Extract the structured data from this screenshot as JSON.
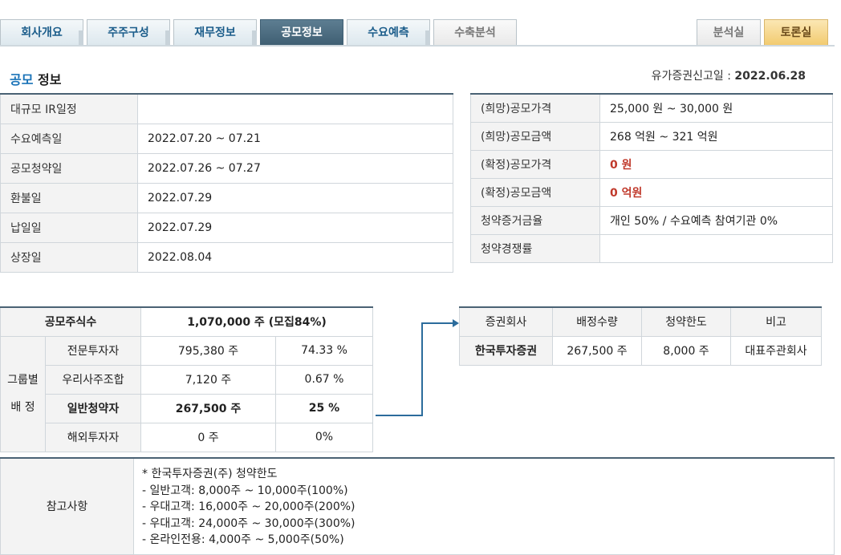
{
  "tabs": [
    {
      "label": "회사개요",
      "state": "normal"
    },
    {
      "label": "주주구성",
      "state": "normal"
    },
    {
      "label": "재무정보",
      "state": "normal"
    },
    {
      "label": "공모정보",
      "state": "active"
    },
    {
      "label": "수요예측",
      "state": "normal"
    },
    {
      "label": "수축분석",
      "state": "disabled"
    }
  ],
  "right_tabs": [
    {
      "label": "분석실",
      "state": "disabled"
    },
    {
      "label": "토론실",
      "state": "highlight"
    }
  ],
  "section_title": {
    "accent": "공모",
    "rest": "정보"
  },
  "registration": {
    "label": "유가증권신고일 : ",
    "date": "2022.06.28"
  },
  "schedule": [
    {
      "label": "대규모 IR일정",
      "value": ""
    },
    {
      "label": "수요예측일",
      "value": "2022.07.20 ~ 07.21"
    },
    {
      "label": "공모청약일",
      "value": "2022.07.26 ~ 07.27"
    },
    {
      "label": "환불일",
      "value": "2022.07.29"
    },
    {
      "label": "납일일",
      "value": "2022.07.29"
    },
    {
      "label": "상장일",
      "value": "2022.08.04"
    }
  ],
  "pricing": [
    {
      "label": "(희망)공모가격",
      "value": "25,000 원 ~ 30,000 원"
    },
    {
      "label": "(희망)공모금액",
      "value": "268 억원  ~ 321 억원"
    },
    {
      "label": "(확정)공모가격",
      "value": "0 원"
    },
    {
      "label": "(확정)공모금액",
      "value": "0 억원"
    },
    {
      "label": "청약증거금율",
      "value": "개인 50% / 수요예측 참여기관 0%"
    },
    {
      "label": "청약경쟁률",
      "value": ""
    }
  ],
  "allocation": {
    "total_label": "공모주식수",
    "total_value": "1,070,000 주 (모집84%)",
    "group_label": "그룹별",
    "group_label2": "배 정",
    "rows": [
      {
        "label": "전문투자자",
        "shares": "795,380 주",
        "pct": "74.33 %"
      },
      {
        "label": "우리사주조합",
        "shares": "7,120 주",
        "pct": "0.67 %"
      },
      {
        "label": "일반청약자",
        "shares": "267,500 주",
        "pct": "25 %"
      },
      {
        "label": "해외투자자",
        "shares": "0 주",
        "pct": "0%"
      }
    ]
  },
  "broker": {
    "headers": [
      "증권회사",
      "배정수량",
      "청약한도",
      "비고"
    ],
    "rows": [
      {
        "name": "한국투자증권",
        "qty": "267,500 주",
        "limit": "8,000 주",
        "note": "대표주관회사"
      }
    ]
  },
  "reference": {
    "label": "참고사항",
    "lines": [
      "* 한국투자증권(주) 청약한도",
      "- 일반고객: 8,000주 ~ 10,000주(100%)",
      "- 우대고객: 16,000주 ~ 20,000주(200%)",
      "- 우대고객: 24,000주 ~ 30,000주(300%)",
      "- 온라인전용: 4,000주 ~ 5,000주(50%)"
    ]
  },
  "colors": {
    "accent_blue": "#1a73b8",
    "confirmed_red": "#c0392b",
    "table_top": "#4a6274",
    "arrow": "#2c6c9c"
  }
}
